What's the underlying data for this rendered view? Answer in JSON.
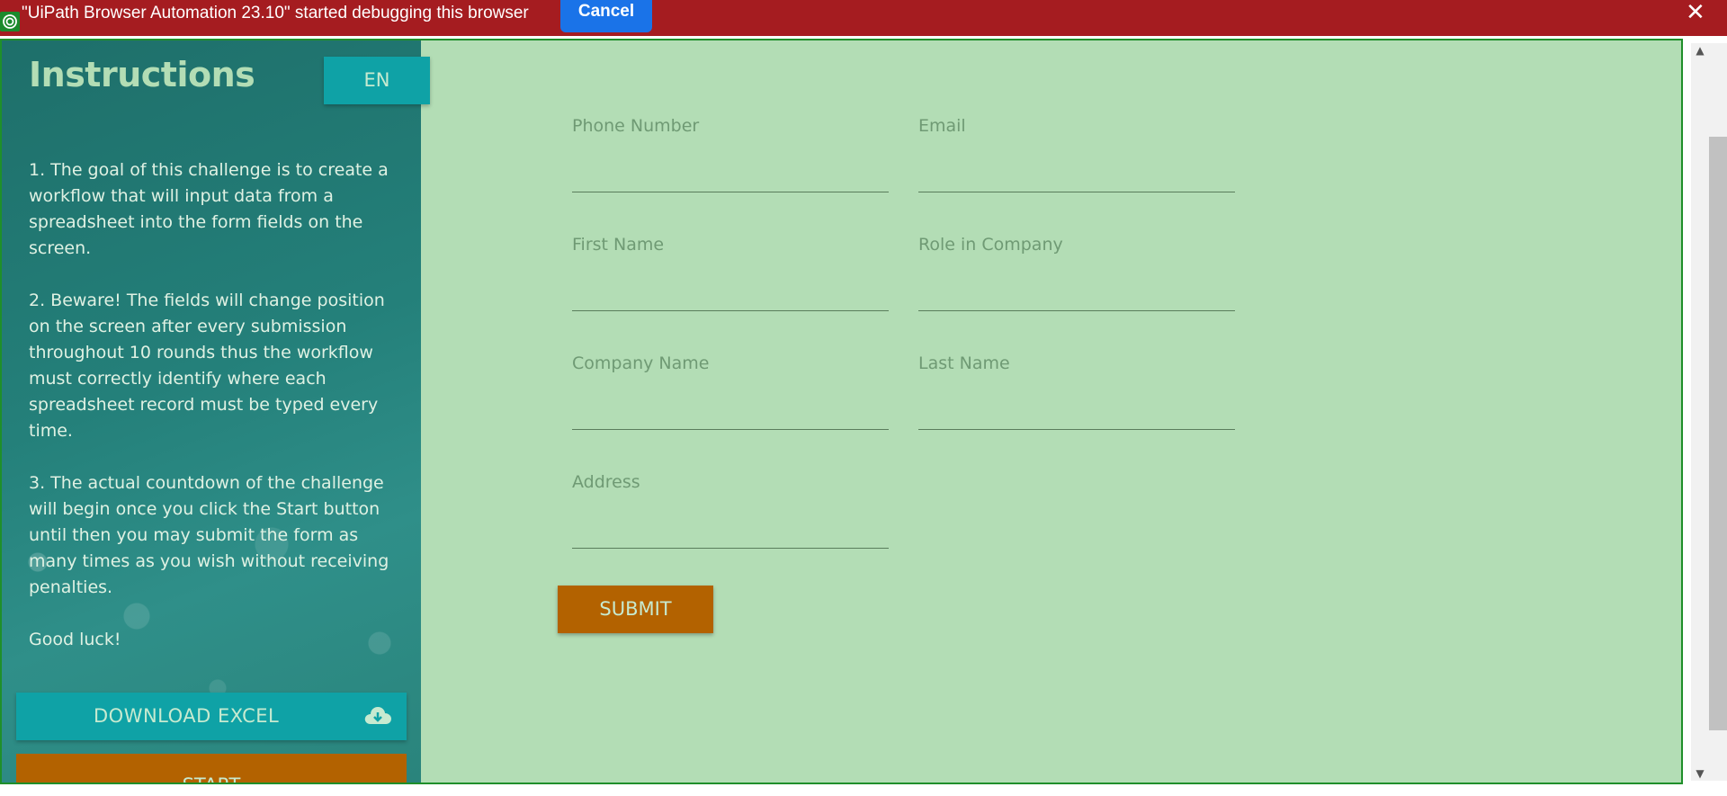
{
  "debug_bar": {
    "message": "\"UiPath Browser Automation 23.10\" started debugging this browser",
    "cancel_label": "Cancel",
    "close_label": "✕",
    "color": "#a51c20"
  },
  "sidebar": {
    "title": "Instructions",
    "language": "EN",
    "paragraphs": [
      "1. The goal of this challenge is to create a workflow that will input data from a spreadsheet into the form fields on the screen.",
      "2. Beware! The fields will change position on the screen after every submission throughout 10 rounds thus the workflow must correctly identify where each spreadsheet record must be typed every time.",
      "3. The actual countdown of the challenge will begin once you click the Start button until then you may submit the form as many times as you wish without receiving penalties.",
      "Good luck!"
    ],
    "download_label": "DOWNLOAD EXCEL",
    "download_icon": "cloud-download-icon",
    "start_label": "START"
  },
  "form": {
    "fields": [
      {
        "label": "Phone Number",
        "value": ""
      },
      {
        "label": "Email",
        "value": ""
      },
      {
        "label": "First Name",
        "value": ""
      },
      {
        "label": "Role in Company",
        "value": ""
      },
      {
        "label": "Company Name",
        "value": ""
      },
      {
        "label": "Last Name",
        "value": ""
      },
      {
        "label": "Address",
        "value": ""
      }
    ],
    "submit_label": "SUBMIT"
  },
  "colors": {
    "page_bg": "#b3ddb5",
    "accent_teal": "#0fa2a6",
    "accent_orange": "#b36200",
    "frame_border": "#1f8f2a"
  }
}
